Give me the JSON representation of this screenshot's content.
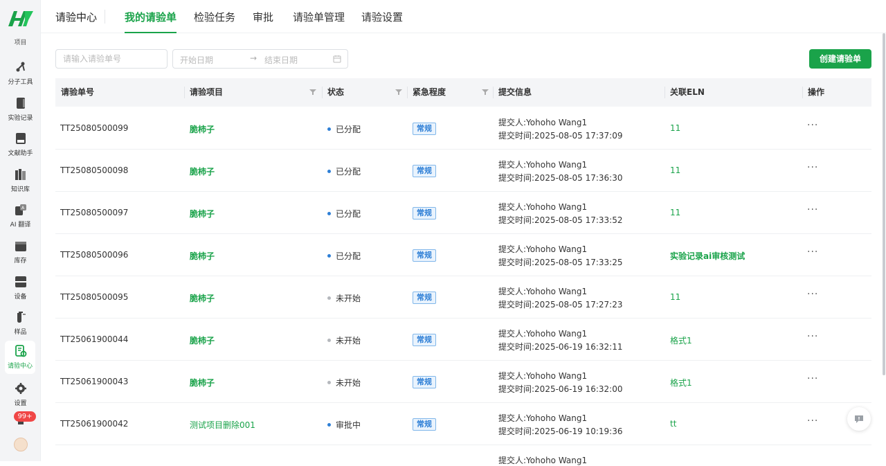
{
  "sidebar": {
    "cut_label": "项目",
    "items": [
      {
        "label": "分子工具",
        "icon": "molecule-tool-icon"
      },
      {
        "label": "实验记录",
        "icon": "experiment-record-icon"
      },
      {
        "label": "文献助手",
        "icon": "literature-icon"
      },
      {
        "label": "知识库",
        "icon": "knowledge-base-icon"
      },
      {
        "label": "AI 翻译",
        "icon": "translate-icon"
      },
      {
        "label": "库存",
        "icon": "inventory-icon"
      },
      {
        "label": "设备",
        "icon": "device-icon"
      },
      {
        "label": "样品",
        "icon": "sample-icon"
      },
      {
        "label": "请验中心",
        "icon": "inspection-center-icon"
      },
      {
        "label": "设置",
        "icon": "settings-icon"
      }
    ],
    "active_item": "请验中心",
    "notification_badge": "99+"
  },
  "topnav": {
    "section": "请验中心",
    "tabs": [
      "我的请验单",
      "检验任务",
      "审批",
      "请验单管理",
      "请验设置"
    ],
    "active_tab": "我的请验单"
  },
  "filters": {
    "search_placeholder": "请输入请验单号",
    "start_date_placeholder": "开始日期",
    "arrow": "→",
    "end_date_placeholder": "结束日期",
    "create_button": "创建请验单"
  },
  "table": {
    "columns": [
      "请验单号",
      "请验项目",
      "状态",
      "紧急程度",
      "提交信息",
      "关联ELN",
      "操作"
    ],
    "rows": [
      {
        "id": "TT25080500099",
        "project": "脆柿子",
        "status": "已分配",
        "urgency": "常规",
        "submitter": "提交人:Yohoho Wang1",
        "time": "提交时间:2025-08-05 17:37:09",
        "eln": "11",
        "ops": "···"
      },
      {
        "id": "TT25080500098",
        "project": "脆柿子",
        "status": "已分配",
        "urgency": "常规",
        "submitter": "提交人:Yohoho Wang1",
        "time": "提交时间:2025-08-05 17:36:30",
        "eln": "11",
        "ops": "···"
      },
      {
        "id": "TT25080500097",
        "project": "脆柿子",
        "status": "已分配",
        "urgency": "常规",
        "submitter": "提交人:Yohoho Wang1",
        "time": "提交时间:2025-08-05 17:33:52",
        "eln": "11",
        "ops": "···"
      },
      {
        "id": "TT25080500096",
        "project": "脆柿子",
        "status": "已分配",
        "urgency": "常规",
        "submitter": "提交人:Yohoho Wang1",
        "time": "提交时间:2025-08-05 17:33:25",
        "eln": "实验记录ai审核测试",
        "ops": "···"
      },
      {
        "id": "TT25080500095",
        "project": "脆柿子",
        "status": "未开始",
        "urgency": "常规",
        "submitter": "提交人:Yohoho Wang1",
        "time": "提交时间:2025-08-05 17:27:23",
        "eln": "11",
        "ops": "···"
      },
      {
        "id": "TT25061900044",
        "project": "脆柿子",
        "status": "未开始",
        "urgency": "常规",
        "submitter": "提交人:Yohoho Wang1",
        "time": "提交时间:2025-06-19 16:32:11",
        "eln": "格式1",
        "ops": "···"
      },
      {
        "id": "TT25061900043",
        "project": "脆柿子",
        "status": "未开始",
        "urgency": "常规",
        "submitter": "提交人:Yohoho Wang1",
        "time": "提交时间:2025-06-19 16:32:00",
        "eln": "格式1",
        "ops": "···"
      },
      {
        "id": "TT25061900042",
        "project": "测试项目删除001",
        "status": "审批中",
        "urgency": "常规",
        "submitter": "提交人:Yohoho Wang1",
        "time": "提交时间:2025-06-19 10:19:36",
        "eln": "tt",
        "ops": "···"
      },
      {
        "id": "",
        "project": "",
        "status": "",
        "urgency": "",
        "submitter": "提交人:Yohoho Wang1",
        "time": "",
        "eln": "",
        "ops": ""
      }
    ]
  },
  "colors": {
    "accent": "#1aa34a",
    "status_assigned": "#2e7fd6",
    "status_pending": "#b5b8bd",
    "status_review": "#2e7fd6",
    "badge": "#f04646"
  }
}
